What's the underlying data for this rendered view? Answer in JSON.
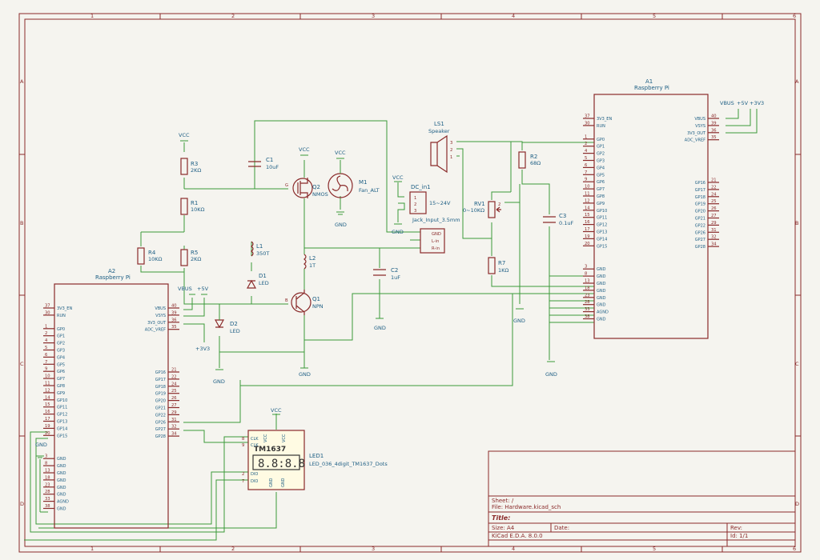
{
  "title_block": {
    "sheet": "Sheet: /",
    "file": "File: Hardware.kicad_sch",
    "title": "Title:",
    "size": "Size: A4",
    "date": "Date:",
    "rev": "Rev:",
    "tool": "KiCad E.D.A. 8.0.0",
    "id": "Id: 1/1"
  },
  "zones": {
    "cols": [
      "1",
      "2",
      "3",
      "4",
      "5",
      "6"
    ],
    "rows": [
      "A",
      "B",
      "C",
      "D"
    ]
  },
  "a1": {
    "ref": "A1",
    "value": "Raspberry Pi",
    "left_pins": [
      {
        "num": "37",
        "name": "3V3_EN"
      },
      {
        "num": "30",
        "name": "RUN"
      },
      {
        "num": "1",
        "name": "GP0"
      },
      {
        "num": "2",
        "name": "GP1"
      },
      {
        "num": "4",
        "name": "GP2"
      },
      {
        "num": "5",
        "name": "GP3"
      },
      {
        "num": "6",
        "name": "GP4"
      },
      {
        "num": "7",
        "name": "GP5"
      },
      {
        "num": "9",
        "name": "GP6"
      },
      {
        "num": "10",
        "name": "GP7"
      },
      {
        "num": "11",
        "name": "GP8"
      },
      {
        "num": "12",
        "name": "GP9"
      },
      {
        "num": "14",
        "name": "GP10"
      },
      {
        "num": "15",
        "name": "GP11"
      },
      {
        "num": "16",
        "name": "GP12"
      },
      {
        "num": "17",
        "name": "GP13"
      },
      {
        "num": "19",
        "name": "GP14"
      },
      {
        "num": "20",
        "name": "GP15"
      },
      {
        "num": "3",
        "name": "GND"
      },
      {
        "num": "8",
        "name": "GND"
      },
      {
        "num": "13",
        "name": "GND"
      },
      {
        "num": "18",
        "name": "GND"
      },
      {
        "num": "23",
        "name": "GND"
      },
      {
        "num": "28",
        "name": "GND"
      },
      {
        "num": "33",
        "name": "AGND"
      },
      {
        "num": "38",
        "name": "GND"
      }
    ],
    "right_pins": [
      {
        "num": "40",
        "name": "VBUS"
      },
      {
        "num": "39",
        "name": "VSYS"
      },
      {
        "num": "36",
        "name": "3V3_OUT"
      },
      {
        "num": "35",
        "name": "ADC_VREF"
      },
      {
        "num": "21",
        "name": "GP16"
      },
      {
        "num": "22",
        "name": "GP17"
      },
      {
        "num": "24",
        "name": "GP18"
      },
      {
        "num": "25",
        "name": "GP19"
      },
      {
        "num": "26",
        "name": "GP20"
      },
      {
        "num": "27",
        "name": "GP21"
      },
      {
        "num": "29",
        "name": "GP22"
      },
      {
        "num": "31",
        "name": "GP26"
      },
      {
        "num": "32",
        "name": "GP27"
      },
      {
        "num": "34",
        "name": "GP28"
      }
    ]
  },
  "a2": {
    "ref": "A2",
    "value": "Raspberry Pi",
    "left_pins": [
      {
        "num": "37",
        "name": "3V3_EN"
      },
      {
        "num": "30",
        "name": "RUN"
      },
      {
        "num": "1",
        "name": "GP0"
      },
      {
        "num": "2",
        "name": "GP1"
      },
      {
        "num": "4",
        "name": "GP2"
      },
      {
        "num": "5",
        "name": "GP3"
      },
      {
        "num": "6",
        "name": "GP4"
      },
      {
        "num": "7",
        "name": "GP5"
      },
      {
        "num": "9",
        "name": "GP6"
      },
      {
        "num": "10",
        "name": "GP7"
      },
      {
        "num": "11",
        "name": "GP8"
      },
      {
        "num": "12",
        "name": "GP9"
      },
      {
        "num": "14",
        "name": "GP10"
      },
      {
        "num": "15",
        "name": "GP11"
      },
      {
        "num": "16",
        "name": "GP12"
      },
      {
        "num": "17",
        "name": "GP13"
      },
      {
        "num": "19",
        "name": "GP14"
      },
      {
        "num": "20",
        "name": "GP15"
      },
      {
        "num": "3",
        "name": "GND"
      },
      {
        "num": "8",
        "name": "GND"
      },
      {
        "num": "13",
        "name": "GND"
      },
      {
        "num": "18",
        "name": "GND"
      },
      {
        "num": "23",
        "name": "GND"
      },
      {
        "num": "28",
        "name": "GND"
      },
      {
        "num": "33",
        "name": "AGND"
      },
      {
        "num": "38",
        "name": "GND"
      }
    ],
    "right_pins": [
      {
        "num": "40",
        "name": "VBUS"
      },
      {
        "num": "39",
        "name": "VSYS"
      },
      {
        "num": "36",
        "name": "3V3_OUT"
      },
      {
        "num": "35",
        "name": "ADC_VREF"
      },
      {
        "num": "21",
        "name": "GP16"
      },
      {
        "num": "22",
        "name": "GP17"
      },
      {
        "num": "24",
        "name": "GP18"
      },
      {
        "num": "25",
        "name": "GP19"
      },
      {
        "num": "26",
        "name": "GP20"
      },
      {
        "num": "27",
        "name": "GP21"
      },
      {
        "num": "29",
        "name": "GP22"
      },
      {
        "num": "31",
        "name": "GP26"
      },
      {
        "num": "32",
        "name": "GP27"
      },
      {
        "num": "34",
        "name": "GP28"
      }
    ]
  },
  "components": {
    "r3": {
      "ref": "R3",
      "value": "2KΩ"
    },
    "r1": {
      "ref": "R1",
      "value": "10KΩ"
    },
    "r4": {
      "ref": "R4",
      "value": "10KΩ"
    },
    "r5": {
      "ref": "R5",
      "value": "2KΩ"
    },
    "r2": {
      "ref": "R2",
      "value": "68Ω"
    },
    "r7": {
      "ref": "R7",
      "value": "1KΩ"
    },
    "rv1": {
      "ref": "RV1",
      "value": "0~10KΩ"
    },
    "c1": {
      "ref": "C1",
      "value": "10uF"
    },
    "c2": {
      "ref": "C2",
      "value": "1uF"
    },
    "c3": {
      "ref": "C3",
      "value": "0.1uF"
    },
    "l1": {
      "ref": "L1",
      "value": "350T"
    },
    "l2": {
      "ref": "L2",
      "value": "1T"
    },
    "d1": {
      "ref": "D1",
      "value": "LED"
    },
    "d2": {
      "ref": "D2",
      "value": "LED"
    },
    "q1": {
      "ref": "Q1",
      "value": "NPN"
    },
    "q2": {
      "ref": "Q2",
      "value": "NMOS"
    },
    "m1": {
      "ref": "M1",
      "value": "Fan_ALT"
    },
    "ls1": {
      "ref": "LS1",
      "value": "Speaker"
    },
    "dcin": {
      "ref": "DC_in1",
      "value": "Jack_Input_3.5mm",
      "rating": "15~24V",
      "pins": [
        "1",
        "2",
        "3"
      ],
      "right_pins": [
        "GND",
        "L-in",
        "R-in"
      ]
    },
    "led1": {
      "ref": "LED1",
      "value": "LED_036_4digit_TM1637_Dots",
      "chip": "TM1637",
      "pins": [
        {
          "num": "8",
          "name": "CLK"
        },
        {
          "num": "9",
          "name": "CLK"
        },
        {
          "num": "2",
          "name": "DIO"
        },
        {
          "num": "7",
          "name": "DIO"
        }
      ],
      "top": [
        "VCC",
        "VCC"
      ],
      "bottom": [
        "GND",
        "GND"
      ]
    }
  },
  "power": {
    "vcc": "VCC",
    "gnd": "GND",
    "vbus": "VBUS",
    "v5": "+5V",
    "v33": "+3V3"
  },
  "ls1_pins": [
    "3",
    "2",
    "1"
  ],
  "q2_pins": {
    "g": "G"
  },
  "q1_pins": {
    "b": "B"
  },
  "rv1_pin": "2"
}
